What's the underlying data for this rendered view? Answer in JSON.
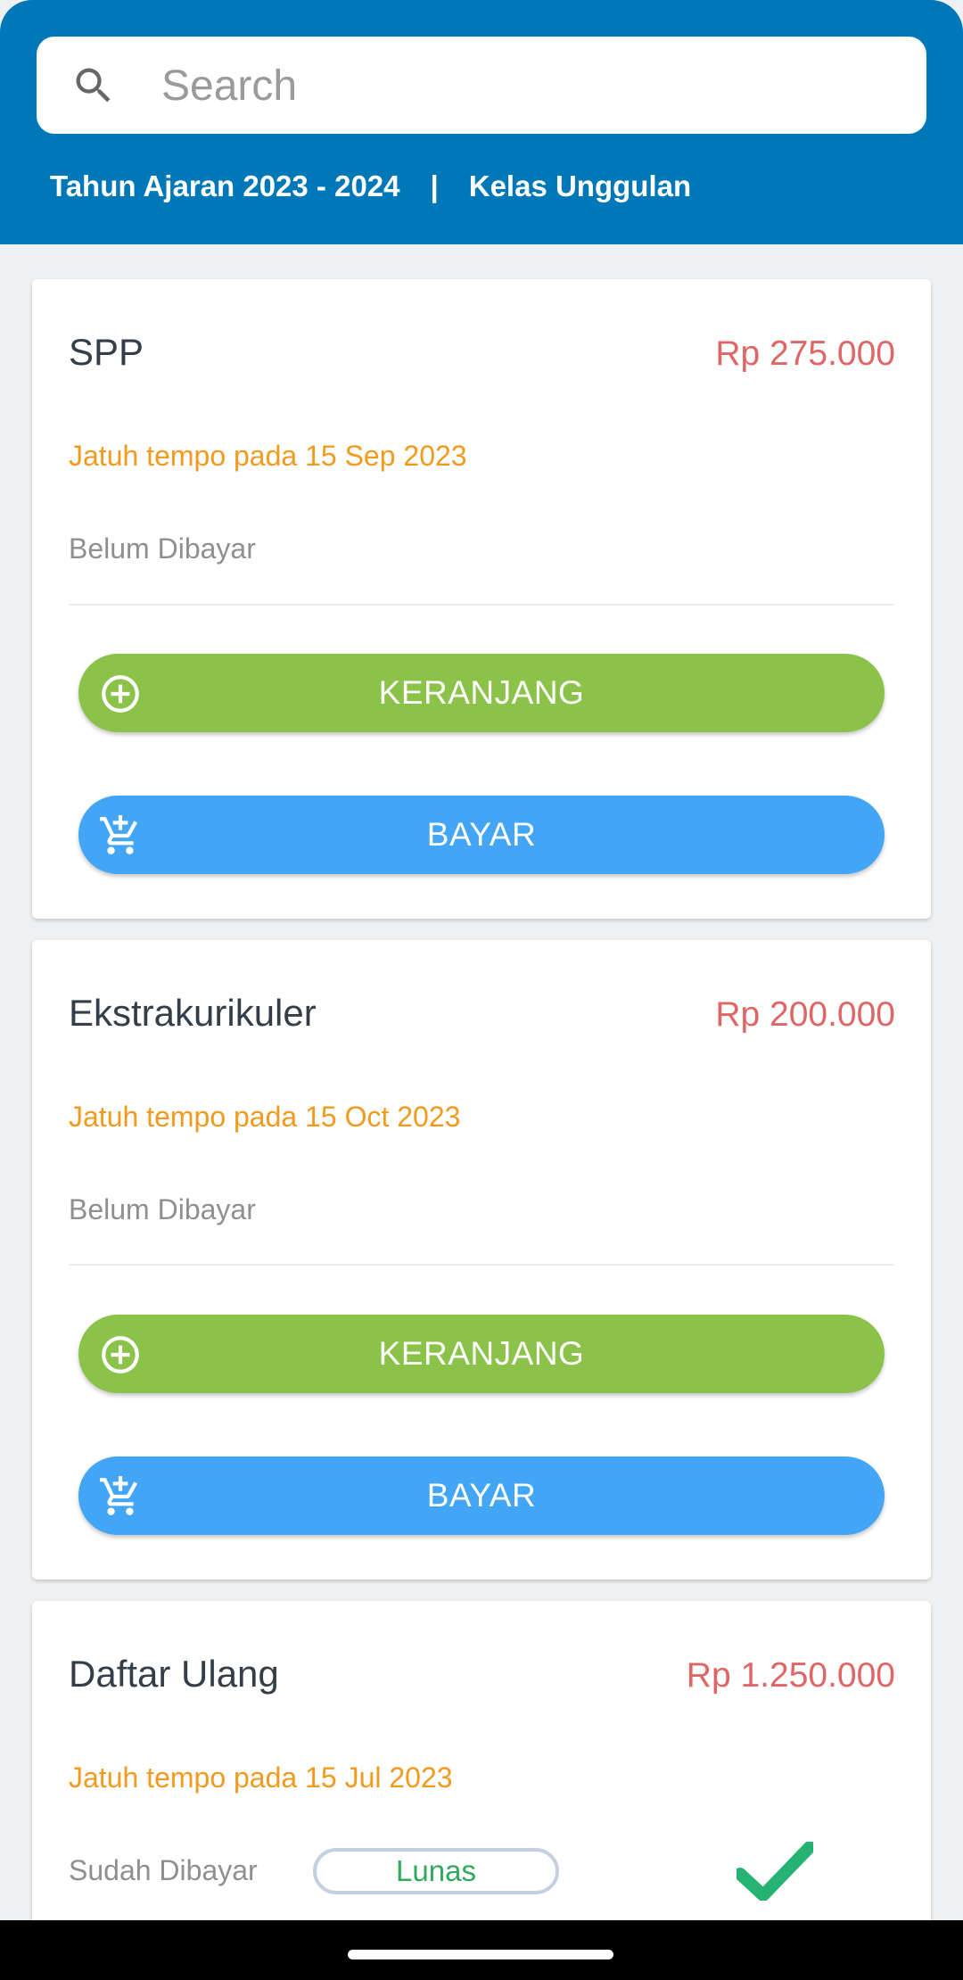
{
  "search": {
    "placeholder": "Search",
    "value": ""
  },
  "header": {
    "year": "Tahun Ajaran 2023 - 2024",
    "separator": "|",
    "class": "Kelas Unggulan"
  },
  "colors": {
    "header": "#0077b7",
    "amount": "#e06666",
    "due": "#f29a1e",
    "cart_button": "#8bc34a",
    "pay_button": "#42a5f5",
    "paid": "#2faa5c"
  },
  "bills": [
    {
      "name": "SPP",
      "amount": "Rp 275.000",
      "due": "Jatuh tempo pada 15 Sep 2023",
      "status": "Belum Dibayar",
      "cart_label": "KERANJANG",
      "pay_label": "BAYAR",
      "cart_icon": "add-circle-icon",
      "pay_icon": "add-cart-icon"
    },
    {
      "name": "Ekstrakurikuler",
      "amount": "Rp 200.000",
      "due": "Jatuh tempo pada 15 Oct 2023",
      "status": "Belum Dibayar",
      "cart_label": "KERANJANG",
      "pay_label": "BAYAR",
      "cart_icon": "add-circle-icon",
      "pay_icon": "add-cart-icon"
    },
    {
      "name": "Daftar Ulang",
      "amount": "Rp 1.250.000",
      "due": "Jatuh tempo pada 15 Jul 2023",
      "status": "Sudah Dibayar",
      "badge": "Lunas",
      "status_icon": "checkmark-icon"
    }
  ]
}
